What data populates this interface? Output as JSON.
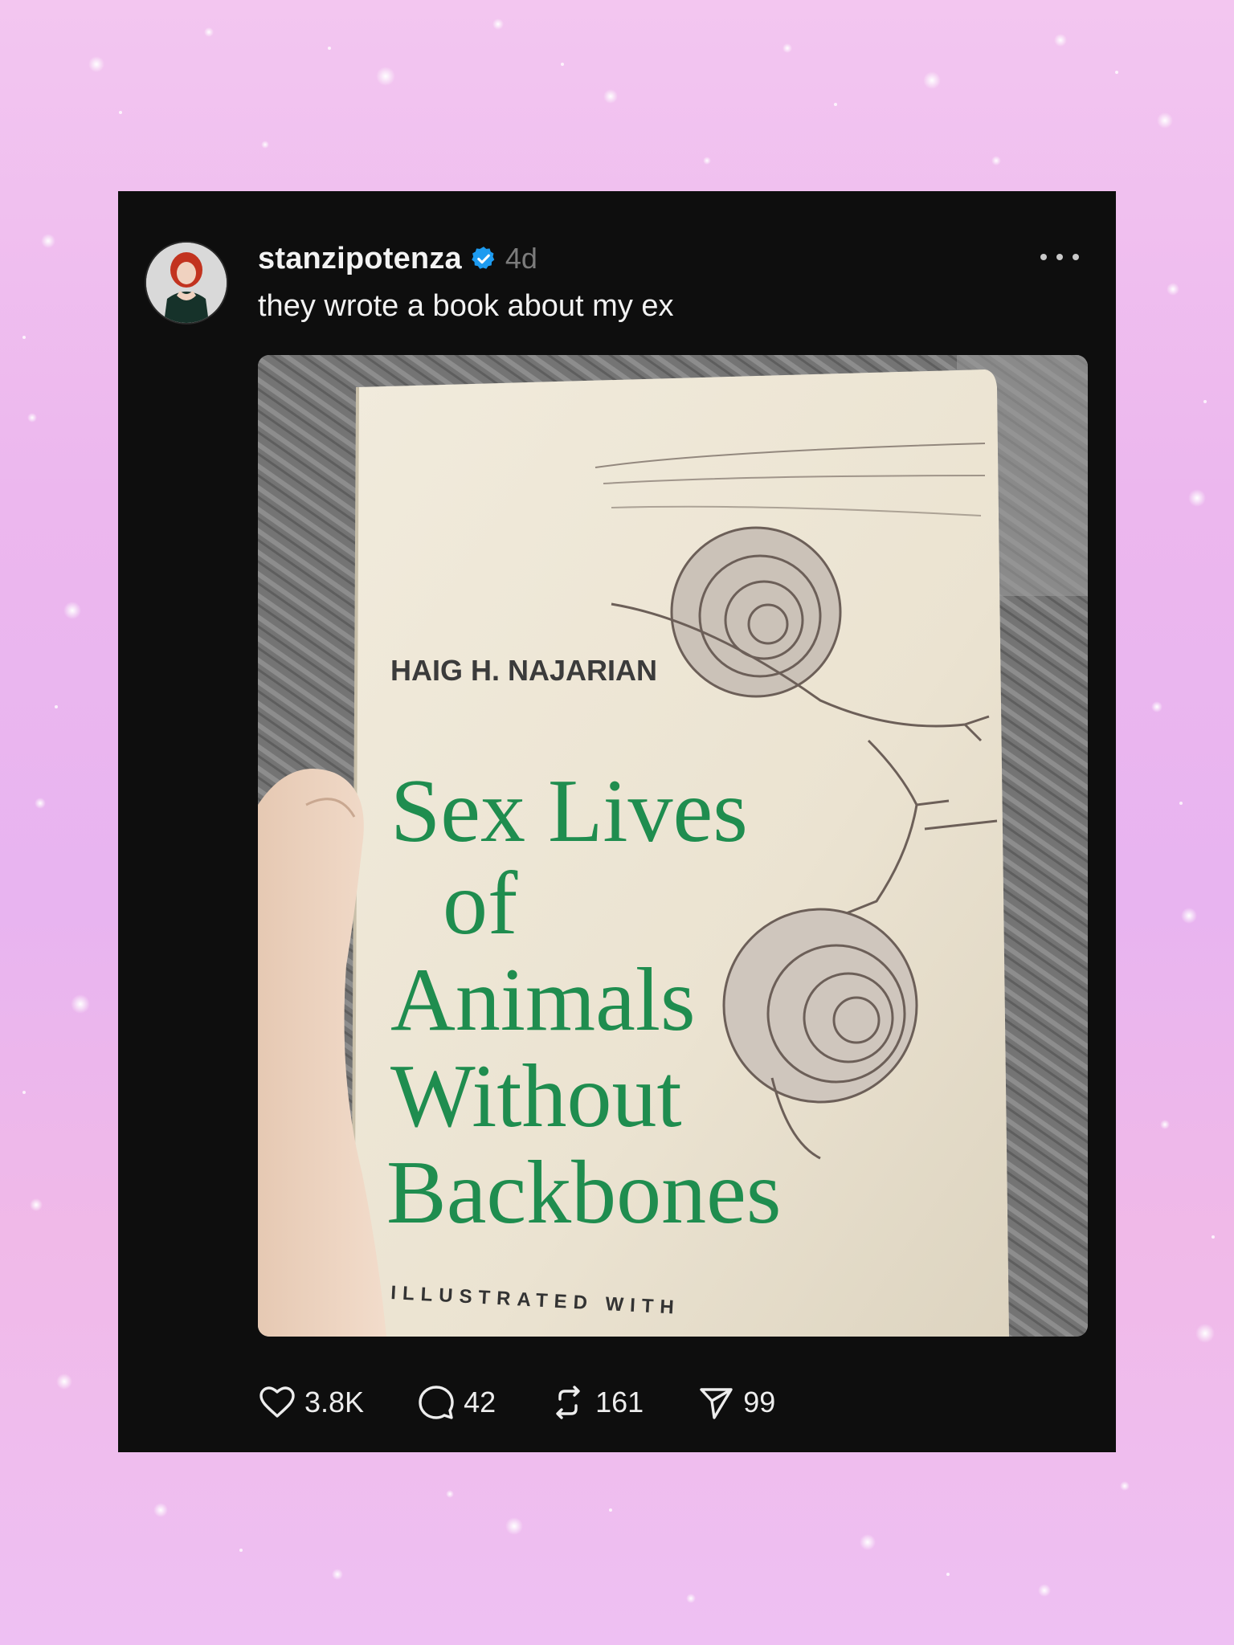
{
  "post": {
    "username": "stanzipotenza",
    "time": "4d",
    "text": "they wrote a book about my ex",
    "more_label": "More options"
  },
  "photo": {
    "book_author": "HAIG H. NAJARIAN",
    "title_line_1": "Sex Lives",
    "title_line_2": "of",
    "title_line_3": "Animals",
    "title_line_4": "Without",
    "title_line_5": "Backbones",
    "subtitle": "ILLUSTRATED WITH",
    "title_color": "#1f8d4f"
  },
  "actions": {
    "likes": "3.8K",
    "comments": "42",
    "reposts": "161",
    "shares": "99"
  },
  "colors": {
    "background": "#ecb7ee",
    "card": "#0e0e0e",
    "verified": "#1d9bf0"
  },
  "icons": {
    "like": "heart-icon",
    "comment": "comment-icon",
    "repost": "repost-icon",
    "share": "send-icon",
    "verified": "verified-badge-icon",
    "more": "more-dots-icon"
  }
}
